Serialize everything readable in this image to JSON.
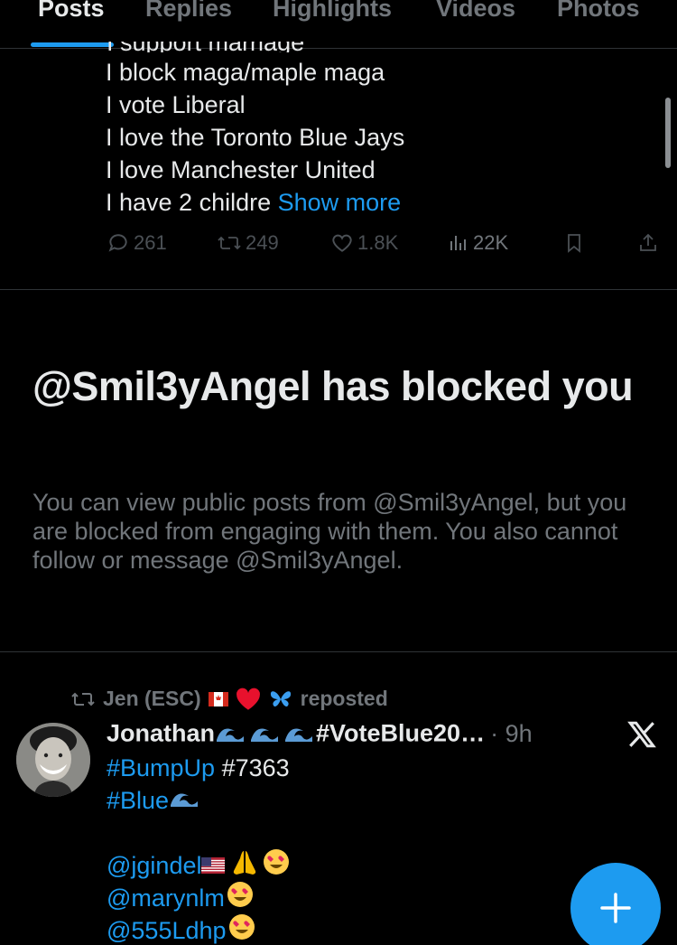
{
  "tabs": [
    {
      "label": "Posts",
      "active": true
    },
    {
      "label": "Replies",
      "active": false
    },
    {
      "label": "Highlights",
      "active": false
    },
    {
      "label": "Videos",
      "active": false
    },
    {
      "label": "Photos",
      "active": false
    }
  ],
  "post1": {
    "partial_line": "I support marriage",
    "bio_lines": [
      "I block maga/maple maga",
      "I vote Liberal",
      "I love the Toronto Blue Jays",
      "I love Manchester United"
    ],
    "last_line": "I have 2 childre",
    "show_more": "Show more",
    "stats": {
      "replies": "261",
      "reposts": "249",
      "likes": "1.8K",
      "views": "22K"
    }
  },
  "blocked": {
    "title": "@Smil3yAngel has blocked you",
    "description": "You can view public posts from @Smil3yAngel, but you are blocked from engaging with them. You also cannot follow or message @Smil3yAngel."
  },
  "post2": {
    "reposted_by": "Jen (ESC)",
    "reposted_label": "reposted",
    "author_name": "Jonathan",
    "author_hashtag": "#VoteBlue20…",
    "time": "· 9h",
    "line1_tag": "#BumpUp",
    "line1_text": "#7363",
    "line2_tag": "#Blue",
    "mentions": [
      "@jgindel",
      "@marynlm",
      "@555Ldhp"
    ]
  },
  "colors": {
    "accent": "#1d9bf0",
    "text": "#e7e9ea",
    "muted": "#71767b",
    "border": "#2f3336",
    "background": "#000000"
  },
  "icons": [
    "reply-icon",
    "repost-icon",
    "like-icon",
    "views-icon",
    "bookmark-icon",
    "share-icon",
    "x-logo-icon",
    "compose-plus-icon"
  ]
}
